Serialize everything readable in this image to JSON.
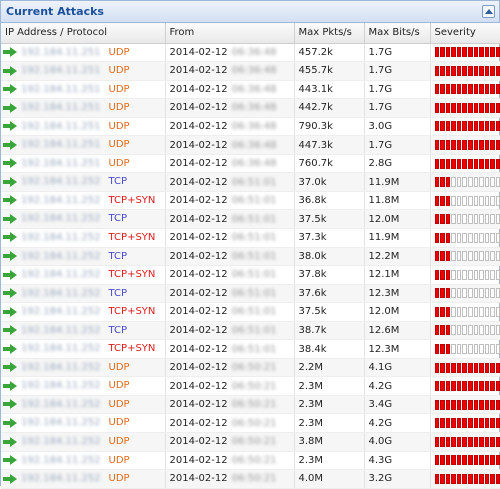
{
  "panel": {
    "title": "Current Attacks"
  },
  "columns": {
    "ip_protocol": "IP Address / Protocol",
    "from": "From",
    "max_pkts": "Max Pkts/s",
    "max_bits": "Max Bits/s",
    "severity": "Severity"
  },
  "rows": [
    {
      "ip": "192.184.11.251",
      "protocol": "UDP",
      "date": "2014-02-12",
      "time": "06:36:48",
      "pkts": "457.2k",
      "bits": "1.7G",
      "severity": 12
    },
    {
      "ip": "192.184.11.251",
      "protocol": "UDP",
      "date": "2014-02-12",
      "time": "06:36:48",
      "pkts": "455.7k",
      "bits": "1.7G",
      "severity": 12
    },
    {
      "ip": "192.184.11.251",
      "protocol": "UDP",
      "date": "2014-02-12",
      "time": "06:36:48",
      "pkts": "443.1k",
      "bits": "1.7G",
      "severity": 12
    },
    {
      "ip": "192.184.11.251",
      "protocol": "UDP",
      "date": "2014-02-12",
      "time": "06:36:48",
      "pkts": "442.7k",
      "bits": "1.7G",
      "severity": 12
    },
    {
      "ip": "192.184.11.251",
      "protocol": "UDP",
      "date": "2014-02-12",
      "time": "06:36:48",
      "pkts": "790.3k",
      "bits": "3.0G",
      "severity": 12
    },
    {
      "ip": "192.184.11.251",
      "protocol": "UDP",
      "date": "2014-02-12",
      "time": "06:36:48",
      "pkts": "447.3k",
      "bits": "1.7G",
      "severity": 12
    },
    {
      "ip": "192.184.11.251",
      "protocol": "UDP",
      "date": "2014-02-12",
      "time": "06:36:48",
      "pkts": "760.7k",
      "bits": "2.8G",
      "severity": 12
    },
    {
      "ip": "192.184.11.252",
      "protocol": "TCP",
      "date": "2014-02-12",
      "time": "06:51:01",
      "pkts": "37.0k",
      "bits": "11.9M",
      "severity": 3
    },
    {
      "ip": "192.184.11.252",
      "protocol": "TCP+SYN",
      "date": "2014-02-12",
      "time": "06:51:01",
      "pkts": "36.8k",
      "bits": "11.8M",
      "severity": 3
    },
    {
      "ip": "192.184.11.252",
      "protocol": "TCP",
      "date": "2014-02-12",
      "time": "06:51:01",
      "pkts": "37.5k",
      "bits": "12.0M",
      "severity": 3
    },
    {
      "ip": "192.184.11.252",
      "protocol": "TCP+SYN",
      "date": "2014-02-12",
      "time": "06:51:01",
      "pkts": "37.3k",
      "bits": "11.9M",
      "severity": 3
    },
    {
      "ip": "192.184.11.252",
      "protocol": "TCP",
      "date": "2014-02-12",
      "time": "06:51:01",
      "pkts": "38.0k",
      "bits": "12.2M",
      "severity": 3
    },
    {
      "ip": "192.184.11.252",
      "protocol": "TCP+SYN",
      "date": "2014-02-12",
      "time": "06:51:01",
      "pkts": "37.8k",
      "bits": "12.1M",
      "severity": 3
    },
    {
      "ip": "192.184.11.252",
      "protocol": "TCP",
      "date": "2014-02-12",
      "time": "06:51:01",
      "pkts": "37.6k",
      "bits": "12.3M",
      "severity": 3
    },
    {
      "ip": "192.184.11.252",
      "protocol": "TCP+SYN",
      "date": "2014-02-12",
      "time": "06:51:01",
      "pkts": "37.5k",
      "bits": "12.0M",
      "severity": 3
    },
    {
      "ip": "192.184.11.252",
      "protocol": "TCP",
      "date": "2014-02-12",
      "time": "06:51:01",
      "pkts": "38.7k",
      "bits": "12.6M",
      "severity": 3
    },
    {
      "ip": "192.184.11.252",
      "protocol": "TCP+SYN",
      "date": "2014-02-12",
      "time": "06:51:01",
      "pkts": "38.4k",
      "bits": "12.3M",
      "severity": 3
    },
    {
      "ip": "192.184.11.252",
      "protocol": "UDP",
      "date": "2014-02-12",
      "time": "06:50:21",
      "pkts": "2.2M",
      "bits": "4.1G",
      "severity": 12
    },
    {
      "ip": "192.184.11.252",
      "protocol": "UDP",
      "date": "2014-02-12",
      "time": "06:50:21",
      "pkts": "2.3M",
      "bits": "4.2G",
      "severity": 12
    },
    {
      "ip": "192.184.11.252",
      "protocol": "UDP",
      "date": "2014-02-12",
      "time": "06:50:21",
      "pkts": "2.3M",
      "bits": "3.4G",
      "severity": 12
    },
    {
      "ip": "192.184.11.252",
      "protocol": "UDP",
      "date": "2014-02-12",
      "time": "06:50:21",
      "pkts": "2.3M",
      "bits": "4.2G",
      "severity": 12
    },
    {
      "ip": "192.184.11.252",
      "protocol": "UDP",
      "date": "2014-02-12",
      "time": "06:50:21",
      "pkts": "3.8M",
      "bits": "4.0G",
      "severity": 12
    },
    {
      "ip": "192.184.11.252",
      "protocol": "UDP",
      "date": "2014-02-12",
      "time": "06:50:21",
      "pkts": "2.3M",
      "bits": "4.3G",
      "severity": 12
    },
    {
      "ip": "192.184.11.252",
      "protocol": "UDP",
      "date": "2014-02-12",
      "time": "06:50:21",
      "pkts": "4.0M",
      "bits": "3.2G",
      "severity": 12
    }
  ],
  "severity_max": 12,
  "icons": {
    "row_marker": "arrow-right-icon",
    "collapse": "collapse-up-icon"
  },
  "colors": {
    "udp": "#e06b1c",
    "tcp": "#4b4bd1",
    "tcp_syn": "#e01c1c",
    "severity_on": "#ee0000",
    "arrow": "#3aa53a",
    "title": "#1b4f9c"
  }
}
